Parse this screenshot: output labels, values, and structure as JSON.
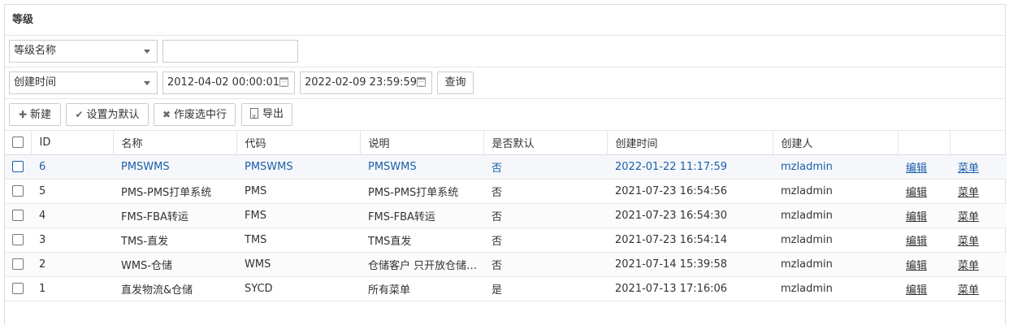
{
  "panel": {
    "title": "等级"
  },
  "filter1": {
    "field": "等级名称",
    "value": ""
  },
  "filter2": {
    "field": "创建时间",
    "start": "2012-04-02 00:00:01",
    "end": "2022-02-09 23:59:59",
    "query_label": "查询"
  },
  "toolbar": {
    "new_label": "新建",
    "set_default_label": "设置为默认",
    "void_label": "作废选中行",
    "export_label": "导出"
  },
  "table": {
    "headers": [
      "ID",
      "名称",
      "代码",
      "说明",
      "是否默认",
      "创建时间",
      "创建人",
      "",
      ""
    ],
    "rows": [
      {
        "id": "6",
        "name": "PMSWMS",
        "code": "PMSWMS",
        "desc": "PMSWMS",
        "default": "否",
        "created": "2022-01-22 11:17:59",
        "creator": "mzladmin",
        "edit": "编辑",
        "menu": "菜单"
      },
      {
        "id": "5",
        "name": "PMS-PMS打单系统",
        "code": "PMS",
        "desc": "PMS-PMS打单系统",
        "default": "否",
        "created": "2021-07-23 16:54:56",
        "creator": "mzladmin",
        "edit": "编辑",
        "menu": "菜单"
      },
      {
        "id": "4",
        "name": "FMS-FBA转运",
        "code": "FMS",
        "desc": "FMS-FBA转运",
        "default": "否",
        "created": "2021-07-23 16:54:30",
        "creator": "mzladmin",
        "edit": "编辑",
        "menu": "菜单"
      },
      {
        "id": "3",
        "name": "TMS-直发",
        "code": "TMS",
        "desc": "TMS直发",
        "default": "否",
        "created": "2021-07-23 16:54:14",
        "creator": "mzladmin",
        "edit": "编辑",
        "menu": "菜单"
      },
      {
        "id": "2",
        "name": "WMS-仓储",
        "code": "WMS",
        "desc": "仓储客户 只开放仓储…",
        "default": "否",
        "created": "2021-07-14 15:39:58",
        "creator": "mzladmin",
        "edit": "编辑",
        "menu": "菜单"
      },
      {
        "id": "1",
        "name": "直发物流&仓储",
        "code": "SYCD",
        "desc": "所有菜单",
        "default": "是",
        "created": "2021-07-13 17:16:06",
        "creator": "mzladmin",
        "edit": "编辑",
        "menu": "菜单"
      }
    ]
  },
  "colors": {
    "link_blue": "#1b5fa8",
    "border": "#dddddd"
  },
  "icons": {
    "new": "plus-icon",
    "set_default": "check-icon",
    "void": "x-icon",
    "export": "excel-file-icon",
    "date": "calendar-icon",
    "select": "caret-down-icon"
  }
}
